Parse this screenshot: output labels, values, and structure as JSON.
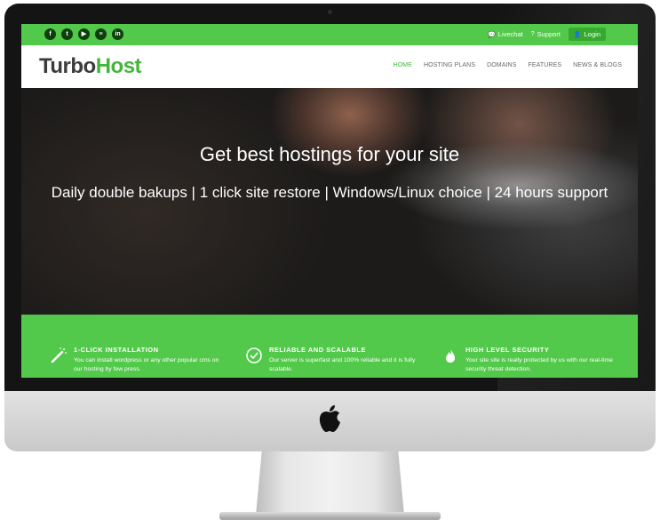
{
  "topbar": {
    "social": [
      {
        "icon": "facebook-icon",
        "glyph": "f"
      },
      {
        "icon": "twitter-icon",
        "glyph": "t"
      },
      {
        "icon": "youtube-icon",
        "glyph": "▶"
      },
      {
        "icon": "stackexchange-icon",
        "glyph": "≡"
      },
      {
        "icon": "linkedin-icon",
        "glyph": "in"
      }
    ],
    "livechat": "Livechat",
    "support": "Support",
    "login": "Login"
  },
  "brand": {
    "part1": "Turbo",
    "part2": "Host"
  },
  "nav": [
    "HOME",
    "HOSTING PLANS",
    "DOMAINS",
    "FEATURES",
    "NEWS & BLOGS"
  ],
  "hero": {
    "title": "Get best hostings for your site",
    "subtitle": "Daily double bakups | 1 click site restore | Windows/Linux choice | 24 hours support"
  },
  "features": [
    {
      "icon": "magic-wand-icon",
      "title": "1-CLICK INSTALLATION",
      "text": "You can install wordpress or any other popular cms on our hosting by few press."
    },
    {
      "icon": "check-circle-icon",
      "title": "RELIABLE AND SCALABLE",
      "text": "Our server is superfast and 100% reliable and it is fully scalable."
    },
    {
      "icon": "flame-icon",
      "title": "HIGH LEVEL SECURITY",
      "text": "Your site site is really protected by us with our real-time security threat detection."
    }
  ],
  "colors": {
    "accent": "#52c94a",
    "accent_dark": "#37a92f",
    "logo_dark": "#3b3b3b",
    "logo_green": "#45b53c"
  }
}
